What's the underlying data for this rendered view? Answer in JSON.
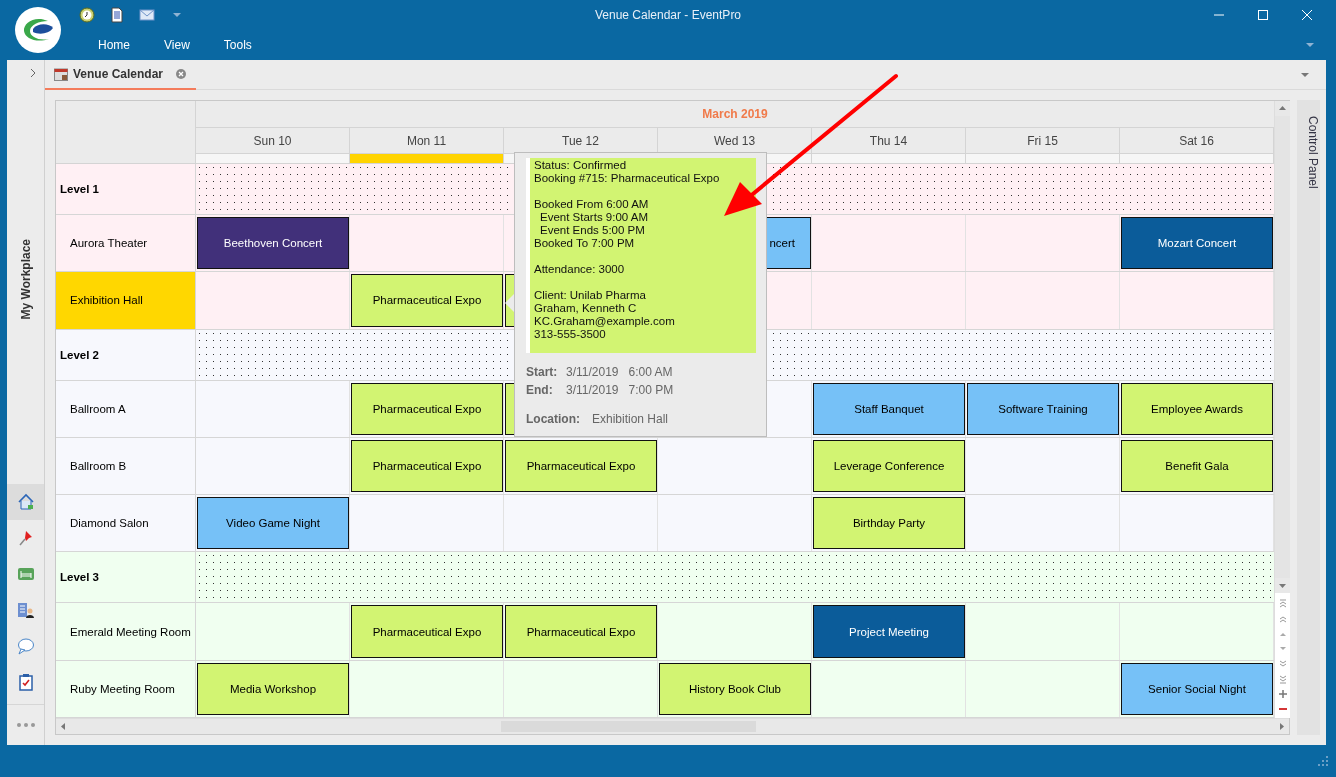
{
  "window": {
    "title": "Venue Calendar - EventPro"
  },
  "menu": [
    "Home",
    "View",
    "Tools"
  ],
  "side_panel": {
    "title": "My Workplace",
    "items": [
      {
        "kind": "home",
        "selected": true
      },
      {
        "kind": "pin",
        "selected": false
      },
      {
        "kind": "bed",
        "selected": false
      },
      {
        "kind": "directory",
        "selected": false
      },
      {
        "kind": "chat",
        "selected": false
      },
      {
        "kind": "clipboard",
        "selected": false
      }
    ]
  },
  "tabs": [
    {
      "label": "Venue Calendar",
      "selected": true
    }
  ],
  "calendar": {
    "month": "March 2019",
    "days": [
      {
        "label": "Sun 10",
        "selected": false
      },
      {
        "label": "Mon 11",
        "selected": true
      },
      {
        "label": "Tue 12",
        "selected": false
      },
      {
        "label": "Wed 13",
        "selected": false
      },
      {
        "label": "Thu 14",
        "selected": false
      },
      {
        "label": "Fri 15",
        "selected": false
      },
      {
        "label": "Sat 16",
        "selected": false
      }
    ],
    "groups": [
      {
        "label": "Level 1",
        "color": "#fff0f4",
        "resources": [
          {
            "label": "Aurora Theater",
            "selected": false,
            "cells": [
              {
                "kind": "event",
                "text": "Beethoven Concert",
                "color": "#41307a"
              },
              {
                "kind": "empty"
              },
              {
                "kind": "empty"
              },
              {
                "kind": "clipped",
                "text": "ncert",
                "color": "#76c1f7"
              },
              {
                "kind": "empty"
              },
              {
                "kind": "empty"
              },
              {
                "kind": "event",
                "text": "Mozart Concert",
                "color": "#0b5c9a"
              }
            ]
          },
          {
            "label": "Exhibition Hall",
            "selected": true,
            "cells": [
              {
                "kind": "empty"
              },
              {
                "kind": "event",
                "text": "Pharmaceutical Expo",
                "color": "#d2f472"
              },
              {
                "kind": "event",
                "color": "#d2f472"
              },
              {
                "kind": "empty"
              },
              {
                "kind": "empty"
              },
              {
                "kind": "empty"
              },
              {
                "kind": "empty"
              }
            ]
          }
        ]
      },
      {
        "label": "Level 2",
        "color": "#f7f8fd",
        "resources": [
          {
            "label": "Ballroom A",
            "selected": false,
            "cells": [
              {
                "kind": "empty"
              },
              {
                "kind": "event",
                "text": "Pharmaceutical Expo",
                "color": "#d2f472"
              },
              {
                "kind": "event",
                "color": "#d2f472"
              },
              {
                "kind": "empty"
              },
              {
                "kind": "event",
                "text": "Staff Banquet",
                "color": "#76c1f7"
              },
              {
                "kind": "event",
                "text": "Software Training",
                "color": "#76c1f7"
              },
              {
                "kind": "event",
                "text": "Employee Awards",
                "color": "#d2f472"
              }
            ]
          },
          {
            "label": "Ballroom B",
            "selected": false,
            "cells": [
              {
                "kind": "empty"
              },
              {
                "kind": "event",
                "text": "Pharmaceutical Expo",
                "color": "#d2f472"
              },
              {
                "kind": "event",
                "text": "Pharmaceutical Expo",
                "color": "#d2f472"
              },
              {
                "kind": "empty"
              },
              {
                "kind": "event",
                "text": "Leverage Conference",
                "color": "#d2f472"
              },
              {
                "kind": "empty"
              },
              {
                "kind": "event",
                "text": "Benefit Gala",
                "color": "#d2f472"
              }
            ]
          },
          {
            "label": "Diamond Salon",
            "selected": false,
            "cells": [
              {
                "kind": "event",
                "text": "Video Game Night",
                "color": "#76c1f7"
              },
              {
                "kind": "empty"
              },
              {
                "kind": "empty"
              },
              {
                "kind": "empty"
              },
              {
                "kind": "event",
                "text": "Birthday Party",
                "color": "#d2f472"
              },
              {
                "kind": "empty"
              },
              {
                "kind": "empty"
              }
            ]
          }
        ]
      },
      {
        "label": "Level 3",
        "color": "#f0fff0",
        "resources": [
          {
            "label": "Emerald Meeting Room",
            "selected": false,
            "cells": [
              {
                "kind": "empty"
              },
              {
                "kind": "event",
                "text": "Pharmaceutical Expo",
                "color": "#d2f472"
              },
              {
                "kind": "event",
                "text": "Pharmaceutical Expo",
                "color": "#d2f472"
              },
              {
                "kind": "empty"
              },
              {
                "kind": "event",
                "text": "Project Meeting",
                "color": "#0b5c9a"
              },
              {
                "kind": "empty"
              },
              {
                "kind": "empty"
              }
            ]
          },
          {
            "label": "Ruby Meeting Room",
            "selected": false,
            "cells": [
              {
                "kind": "event",
                "text": "Media Workshop",
                "color": "#d2f472"
              },
              {
                "kind": "empty"
              },
              {
                "kind": "empty"
              },
              {
                "kind": "event",
                "text": "History Book Club",
                "color": "#d2f472"
              },
              {
                "kind": "empty"
              },
              {
                "kind": "empty"
              },
              {
                "kind": "event",
                "text": "Senior Social Night",
                "color": "#76c1f7"
              }
            ]
          }
        ]
      }
    ]
  },
  "tooltip": {
    "blocks": [
      [
        {
          "text": "Status: Confirmed",
          "indented": false
        },
        {
          "text": "Booking #715: Pharmaceutical Expo",
          "indented": false
        }
      ],
      [
        {
          "text": "Booked From 6:00 AM",
          "indented": false
        },
        {
          "text": "Event Starts 9:00 AM",
          "indented": true
        },
        {
          "text": "Event Ends 5:00 PM",
          "indented": true
        },
        {
          "text": "Booked To 7:00 PM",
          "indented": false
        }
      ],
      [
        {
          "text": "Attendance: 3000",
          "indented": false
        }
      ],
      [
        {
          "text": "Client: Unilab Pharma",
          "indented": false
        },
        {
          "text": "Graham, Kenneth C",
          "indented": false
        },
        {
          "text": "KC.Graham@example.com",
          "indented": false
        },
        {
          "text": "313-555-3500",
          "indented": false
        }
      ]
    ],
    "times": [
      {
        "label": "Start:",
        "date": "3/11/2019",
        "time": "6:00 AM"
      },
      {
        "label": "End:",
        "date": "3/11/2019",
        "time": "7:00 PM"
      }
    ],
    "location": {
      "label": "Location:",
      "value": "Exhibition Hall"
    }
  },
  "control_panel": {
    "title": "Control Panel"
  }
}
